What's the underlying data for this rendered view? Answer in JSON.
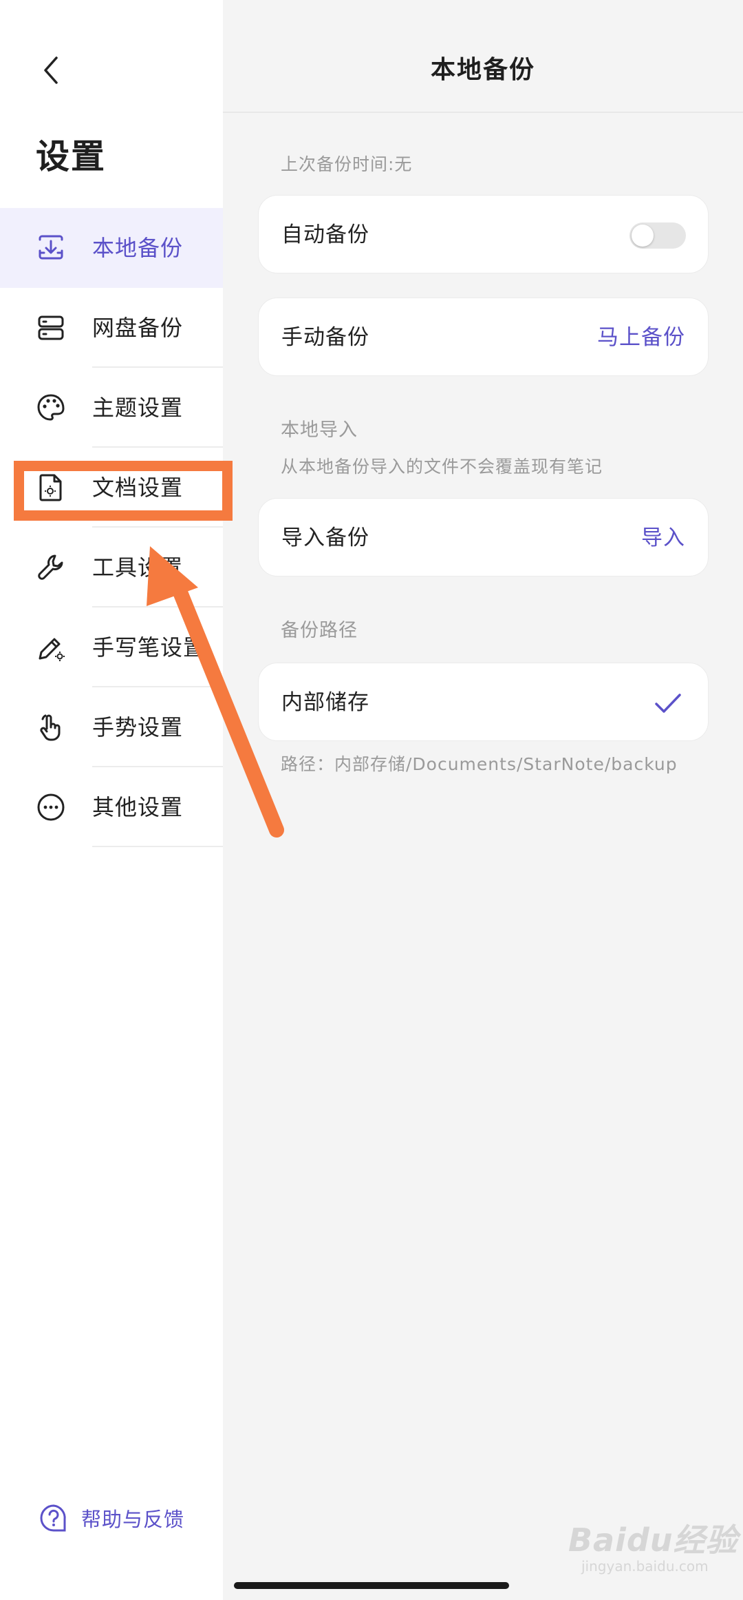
{
  "sidebar": {
    "title": "设置",
    "items": [
      {
        "label": "本地备份",
        "icon": "download-tray-icon",
        "active": true
      },
      {
        "label": "网盘备份",
        "icon": "server-storage-icon",
        "active": false
      },
      {
        "label": "主题设置",
        "icon": "palette-icon",
        "active": false
      },
      {
        "label": "文档设置",
        "icon": "document-gear-icon",
        "active": false
      },
      {
        "label": "工具设置",
        "icon": "wrench-icon",
        "active": false
      },
      {
        "label": "手写笔设置",
        "icon": "pen-gear-icon",
        "active": false
      },
      {
        "label": "手势设置",
        "icon": "hand-gesture-icon",
        "active": false
      },
      {
        "label": "其他设置",
        "icon": "more-dots-icon",
        "active": false
      }
    ],
    "help_label": "帮助与反馈"
  },
  "header": {
    "title": "本地备份"
  },
  "main": {
    "last_backup": "上次备份时间:无",
    "auto_backup": {
      "label": "自动备份",
      "enabled": false
    },
    "manual_backup": {
      "label": "手动备份",
      "action": "马上备份"
    },
    "import_section": {
      "title": "本地导入",
      "note": "从本地备份导入的文件不会覆盖现有笔记"
    },
    "import_backup": {
      "label": "导入备份",
      "action": "导入"
    },
    "path_section": {
      "title": "备份路径"
    },
    "storage": {
      "label": "内部储存",
      "selected": true
    },
    "path_text": "路径：内部存储/Documents/StarNote/backup"
  },
  "watermark": {
    "text": "Baidu经验",
    "sub": "jingyan.baidu.com"
  },
  "colors": {
    "accent": "#5b51c9",
    "annotation": "#f57a3f",
    "active_bg": "#f1f0fd"
  }
}
